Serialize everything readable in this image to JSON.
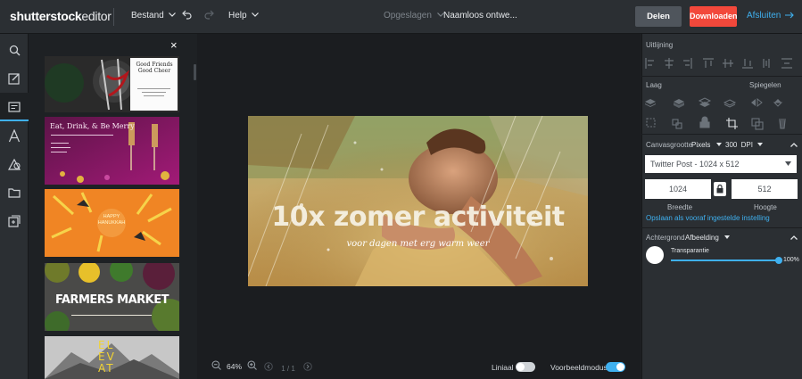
{
  "header": {
    "logo_bold": "shutterstock",
    "logo_light": "editor",
    "menu_file": "Bestand",
    "menu_help": "Help",
    "saved_status": "Opgeslagen",
    "doc_title": "Naamloos ontwe...",
    "share_label": "Delen",
    "download_label": "Downloaden",
    "exit_label": "Afsluiten"
  },
  "rail": {
    "items": [
      "search-icon",
      "image-edit-icon",
      "templates-icon",
      "text-icon",
      "shapes-icon",
      "folder-icon",
      "add-element-icon"
    ],
    "active_index": 2
  },
  "templates": {
    "close_label": "×",
    "items": [
      {
        "name": "good-friends",
        "title": "Good Friends\nGood Cheer"
      },
      {
        "name": "eat-drink-merry",
        "title": "Eat, Drink, & Be Merry"
      },
      {
        "name": "happy-hanukkah",
        "title": "HAPPY\nHANUKKAH"
      },
      {
        "name": "farmers-market",
        "title": "FARMERS MARKET"
      },
      {
        "name": "elevate",
        "title": "EL\nEV\nAT"
      }
    ]
  },
  "artboard": {
    "headline": "10x zomer activiteit",
    "subline": "voor dagen met erg warm weer"
  },
  "bottombar": {
    "zoom": "64%",
    "pager": "1 / 1",
    "ruler_label": "Liniaal",
    "ruler_on": false,
    "preview_label": "Voorbeeldmodus",
    "preview_on": true
  },
  "props": {
    "align_label": "Uitlijning",
    "layer_label": "Laag",
    "mirror_label": "Spiegelen",
    "canvas_size_label": "Canvasgrootte",
    "unit": "Pixels",
    "dpi_value": "300",
    "dpi_label": "DPI",
    "preset": "Twitter Post - 1024 x 512",
    "width": "1024",
    "height": "512",
    "width_label": "Breedte",
    "height_label": "Hoogte",
    "save_preset_link": "Opslaan als vooraf ingestelde instelling",
    "background_label": "Achtergrond",
    "background_type": "Afbeelding",
    "transparency_label": "Transparantie",
    "transparency_value": "100%",
    "transparency_fraction": 1.0
  },
  "colors": {
    "accent": "#3fb0ef",
    "download": "#f2483b",
    "share": "#4f555c",
    "topbar": "#2b2f33",
    "workspace": "#1b1d20"
  }
}
